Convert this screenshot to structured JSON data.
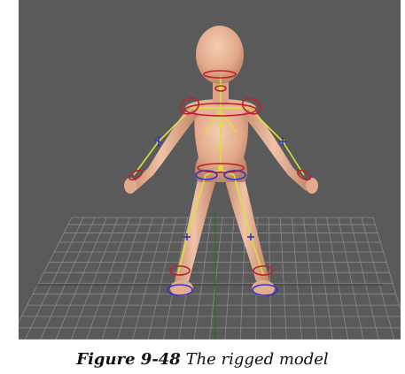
{
  "viewport": {
    "background_color": "#5a5a5a",
    "grid_color": "#8a8a8a",
    "axis_color": "#2a6a2a",
    "skin_color": "#e9b89a",
    "joint_color": "#d8e23a",
    "control_red": "#c02030",
    "control_blue": "#3030c8"
  },
  "caption": {
    "label": "Figure 9-48",
    "text": "The rigged model"
  }
}
